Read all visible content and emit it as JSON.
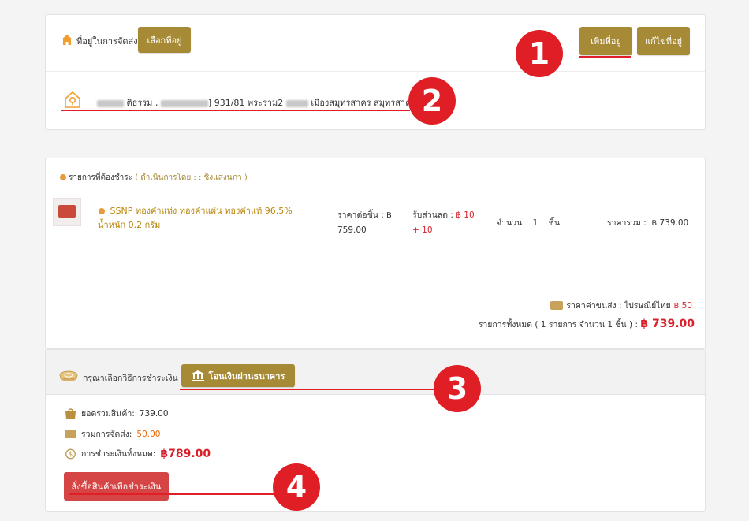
{
  "address_card": {
    "label": "ที่อยู่ในการจัดส่ง",
    "select_button": "เลือกที่อยู่",
    "add_button": "เพิ่มที่อยู่",
    "edit_button": "แก้ไขที่อยู่",
    "address_name_part": "ติธรรม ,",
    "address_text": "] 931/81 พระราม2",
    "address_city": "เมืองสมุทรสาคร สมุทรสาคร 740"
  },
  "order_card": {
    "title": "รายการที่ต้องชำระ",
    "seller": "( ดำเนินการโดย : : ชิงแสงนภา )",
    "product": {
      "name": "SSNP ทองคำแท่ง ทองคำแผ่น ทองคำแท้ 96.5% น้ำหนัก 0.2 กรัม",
      "unit_price_label": "ราคาต่อชิ้น :",
      "unit_price_currency": "฿",
      "unit_price_value": "759.00",
      "discount_label": "รับส่วนลด :",
      "discount_value": "฿ 10",
      "discount_extra": "+ 10",
      "qty_label": "จำนวน",
      "qty_value": "1",
      "qty_unit": "ชิ้น",
      "total_label": "ราคารวม :",
      "total_value": "฿ 739.00"
    },
    "shipping_label": "ราคาค่าขนส่ง : ไปรษณีย์ไทย",
    "shipping_value": "฿ 50",
    "grand_label": "รายการทั้งหมด ( 1 รายการ จำนวน 1 ชิ้น ) :",
    "grand_value": "฿ 739.00"
  },
  "payment_card": {
    "label": "กรุณาเลือกวิธีการชำระเงิน :",
    "bank_button": "โอนเงินผ่านธนาคาร",
    "subtotal_label": "ยอดรวมสินค้า:",
    "subtotal_value": "739.00",
    "shipping_label": "รวมการจัดส่ง:",
    "shipping_value": "50.00",
    "payment_label": "การชำระเงินทั้งหมด:",
    "payment_value": "฿789.00",
    "checkout_button": "สั่งซื้อสินค้าเพื่อชำระเงิน"
  },
  "annotations": [
    "1",
    "2",
    "3",
    "4"
  ],
  "colors": {
    "gold": "#a68a36",
    "red": "#d9202a",
    "annotation": "#e01e25",
    "checkout": "#d64545"
  }
}
